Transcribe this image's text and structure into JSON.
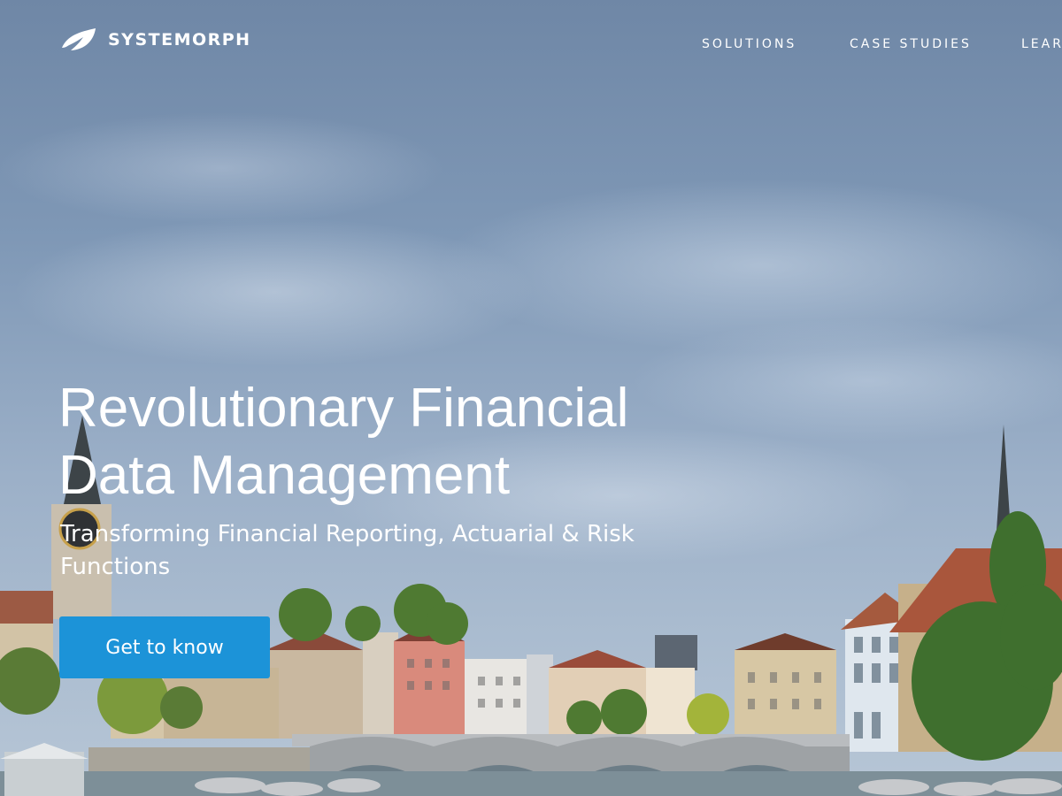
{
  "brand": {
    "name": "SYSTEMORPH",
    "logo_icon": "leaf-icon"
  },
  "nav": {
    "items": [
      "SOLUTIONS",
      "CASE STUDIES",
      "LEAR"
    ]
  },
  "hero": {
    "title_line1": "Revolutionary Financial",
    "title_line2": "Data Management",
    "subtitle_line1": "Transforming Financial Reporting, Actuarial & Risk",
    "subtitle_line2": "Functions",
    "cta_label": "Get to know",
    "background": "zurich-riverside-cityscape"
  },
  "colors": {
    "cta": "#1c93d8",
    "text": "#ffffff"
  }
}
